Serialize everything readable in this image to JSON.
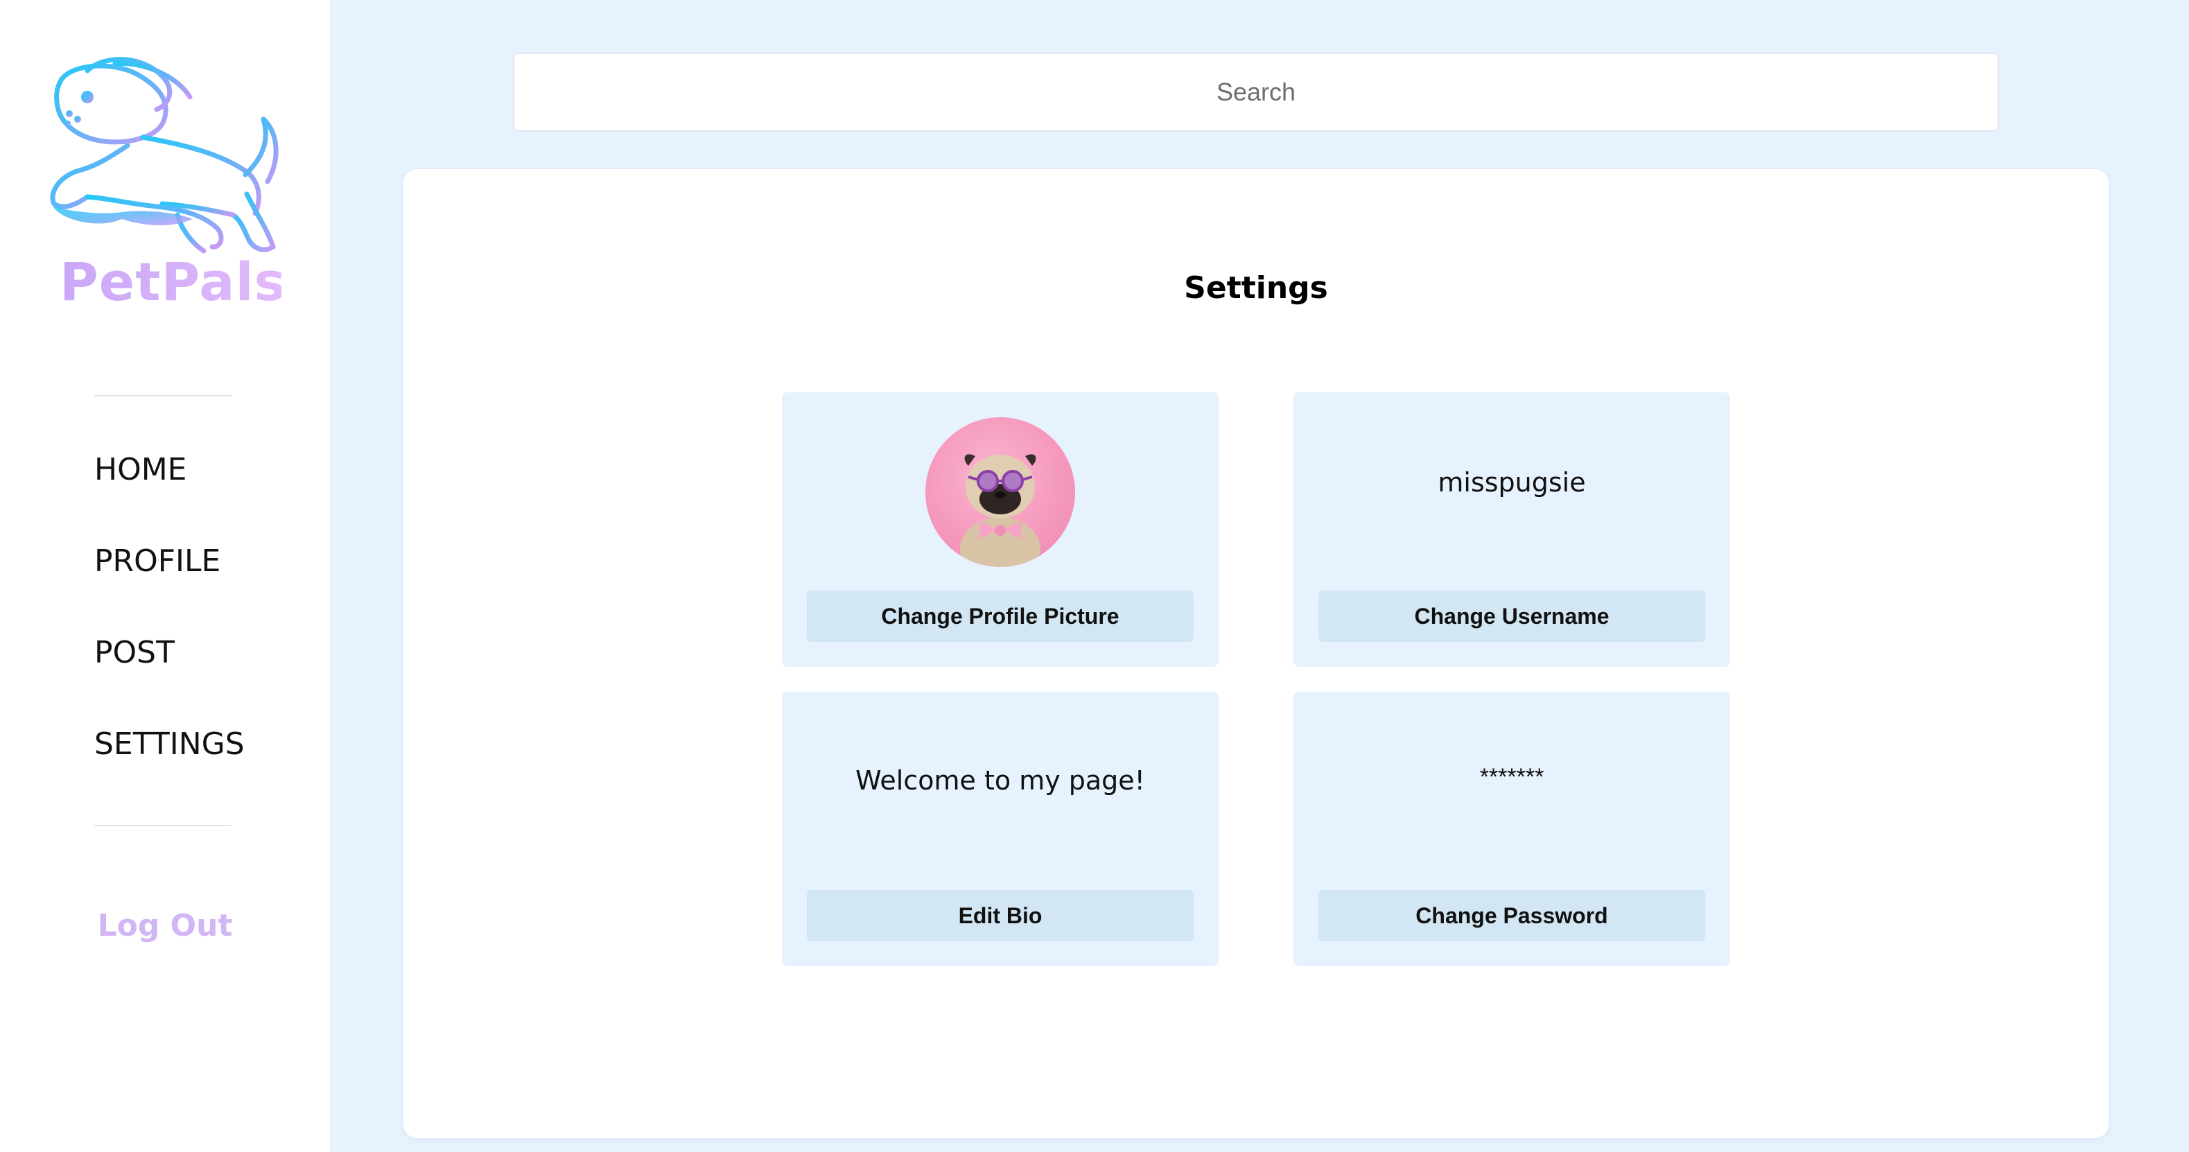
{
  "sidebar": {
    "brand": "PetPals",
    "nav": [
      "HOME",
      "PROFILE",
      "POST",
      "SETTINGS"
    ],
    "logout": "Log Out"
  },
  "search": {
    "placeholder": "Search",
    "value": ""
  },
  "settings": {
    "title": "Settings",
    "profile_picture": {
      "button": "Change Profile Picture"
    },
    "username": {
      "value": "misspugsie",
      "button": "Change Username"
    },
    "bio": {
      "value": "Welcome to my page!",
      "button": "Edit Bio"
    },
    "password": {
      "value": "*******",
      "button": "Change Password"
    }
  },
  "icons": {
    "logo": "jumping-dog-logo",
    "avatar": "pug-with-pink-glasses"
  },
  "colors": {
    "background": "#e6f2fd",
    "brand_gradient_start": "#2fc6f5",
    "brand_gradient_end": "#c79af7",
    "logout": "#d2b5f5",
    "tile": "#e6f2fd",
    "tile_button": "#d2e7f3",
    "avatar_bg": "#f599bd"
  }
}
